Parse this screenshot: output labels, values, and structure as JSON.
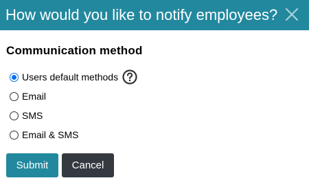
{
  "dialog": {
    "title": "How would you like to notify employees?",
    "close_icon": "close-icon",
    "header_color": "#22889e"
  },
  "section": {
    "title": "Communication method"
  },
  "options": [
    {
      "label": "Users default methods",
      "checked": true,
      "help_icon": "question-circle-icon"
    },
    {
      "label": "Email",
      "checked": false
    },
    {
      "label": "SMS",
      "checked": false
    },
    {
      "label": "Email & SMS",
      "checked": false
    }
  ],
  "buttons": {
    "submit_label": "Submit",
    "cancel_label": "Cancel",
    "submit_color": "#22889e",
    "cancel_color": "#343a40"
  },
  "radio_accent_color": "#0b6ee6"
}
